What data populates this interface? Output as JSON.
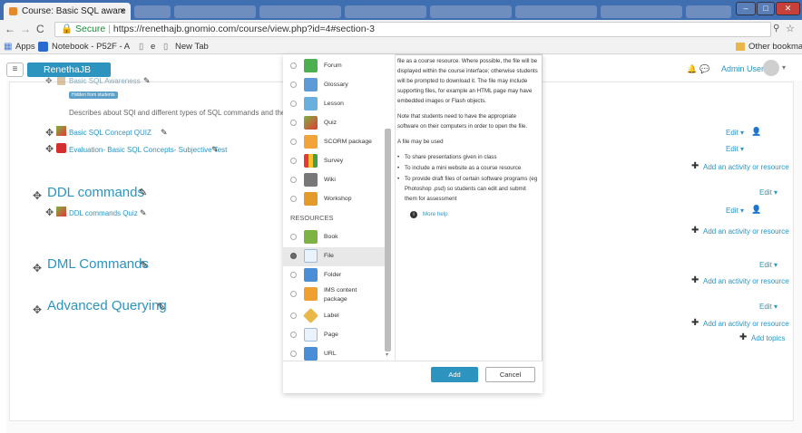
{
  "browser": {
    "tab_title": "Course: Basic SQL aware",
    "secure_label": "Secure",
    "url": "https://renethajb.gnomio.com/course/view.php?id=4#section-3",
    "bookmarks": [
      "Apps",
      "Notebook - P52F - A",
      "e",
      "New Tab"
    ],
    "other_bookmarks": "Other bookmarks"
  },
  "site": {
    "brand": "RenethaJB",
    "user": "Admin User"
  },
  "course": {
    "section0": {
      "item1": "Basic SQL Awareness",
      "badge": "Hidden from students",
      "description": "Describes about SQl and different types of SQL commands and their use",
      "item2": "Basic SQL Concept QUIZ",
      "item3": "Evaluation- Basic SQL Concepts- Subjective Test"
    },
    "sections": [
      {
        "title": "DDL commands",
        "item": "DDL commands Quiz"
      },
      {
        "title": "DML Commands"
      },
      {
        "title": "Advanced Querying"
      }
    ],
    "edit": "Edit ▾",
    "add_activity": "Add an activity or resource",
    "add_topics": "Add topics"
  },
  "dialog": {
    "activities": [
      "Forum",
      "Glossary",
      "Lesson",
      "Quiz",
      "SCORM package",
      "Survey",
      "Wiki",
      "Workshop"
    ],
    "resources_heading": "RESOURCES",
    "resources": [
      "Book",
      "File",
      "Folder",
      "IMS content package",
      "Label",
      "Page",
      "URL"
    ],
    "help": {
      "p1": "file as a course resource. Where possible, the file will be displayed within the course interface; otherwise students will be prompted to download it. The file may include supporting files, for example an HTML page may have embedded images or Flash objects.",
      "p2": "Note that students need to have the appropriate software on their computers in order to open the file.",
      "p3": "A file may be used",
      "bullets": [
        "To share presentations given in class",
        "To include a mini website as a course resource",
        "To provide draft files of certain software programs (eg Photoshop .psd) so students can edit and submit them for assessment"
      ],
      "more": "More help"
    },
    "add_label": "Add",
    "cancel_label": "Cancel"
  },
  "colors": {
    "accent": "#2d94c0",
    "tabstrip": "#3f6fb0"
  }
}
